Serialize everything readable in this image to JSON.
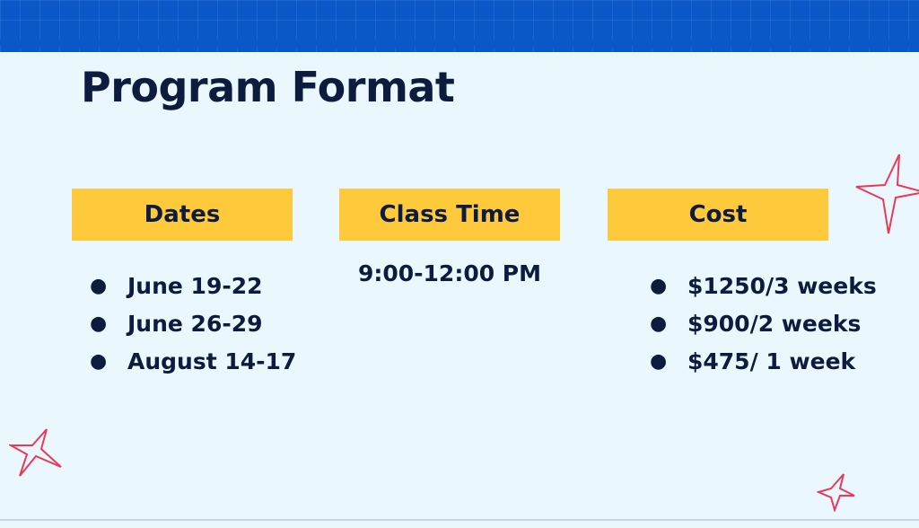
{
  "slide": {
    "title": "Program Format"
  },
  "columns": {
    "dates": {
      "header": "Dates",
      "items": [
        "June 19-22",
        "June 26-29",
        "August 14-17"
      ]
    },
    "class_time": {
      "header": "Class Time",
      "text": "9:00-12:00 PM"
    },
    "cost": {
      "header": "Cost",
      "items": [
        "$1250/3 weeks",
        "$900/2 weeks",
        "$475/ 1 week"
      ]
    }
  },
  "bullet_glyph": "●",
  "colors": {
    "background": "#eaf8fd",
    "top_band": "#0a58c8",
    "header_fill": "#ffc93c",
    "text": "#0d1b3e",
    "star_stroke": "#e8395a"
  },
  "decorations": [
    "star-icon",
    "star-icon",
    "star-icon"
  ]
}
